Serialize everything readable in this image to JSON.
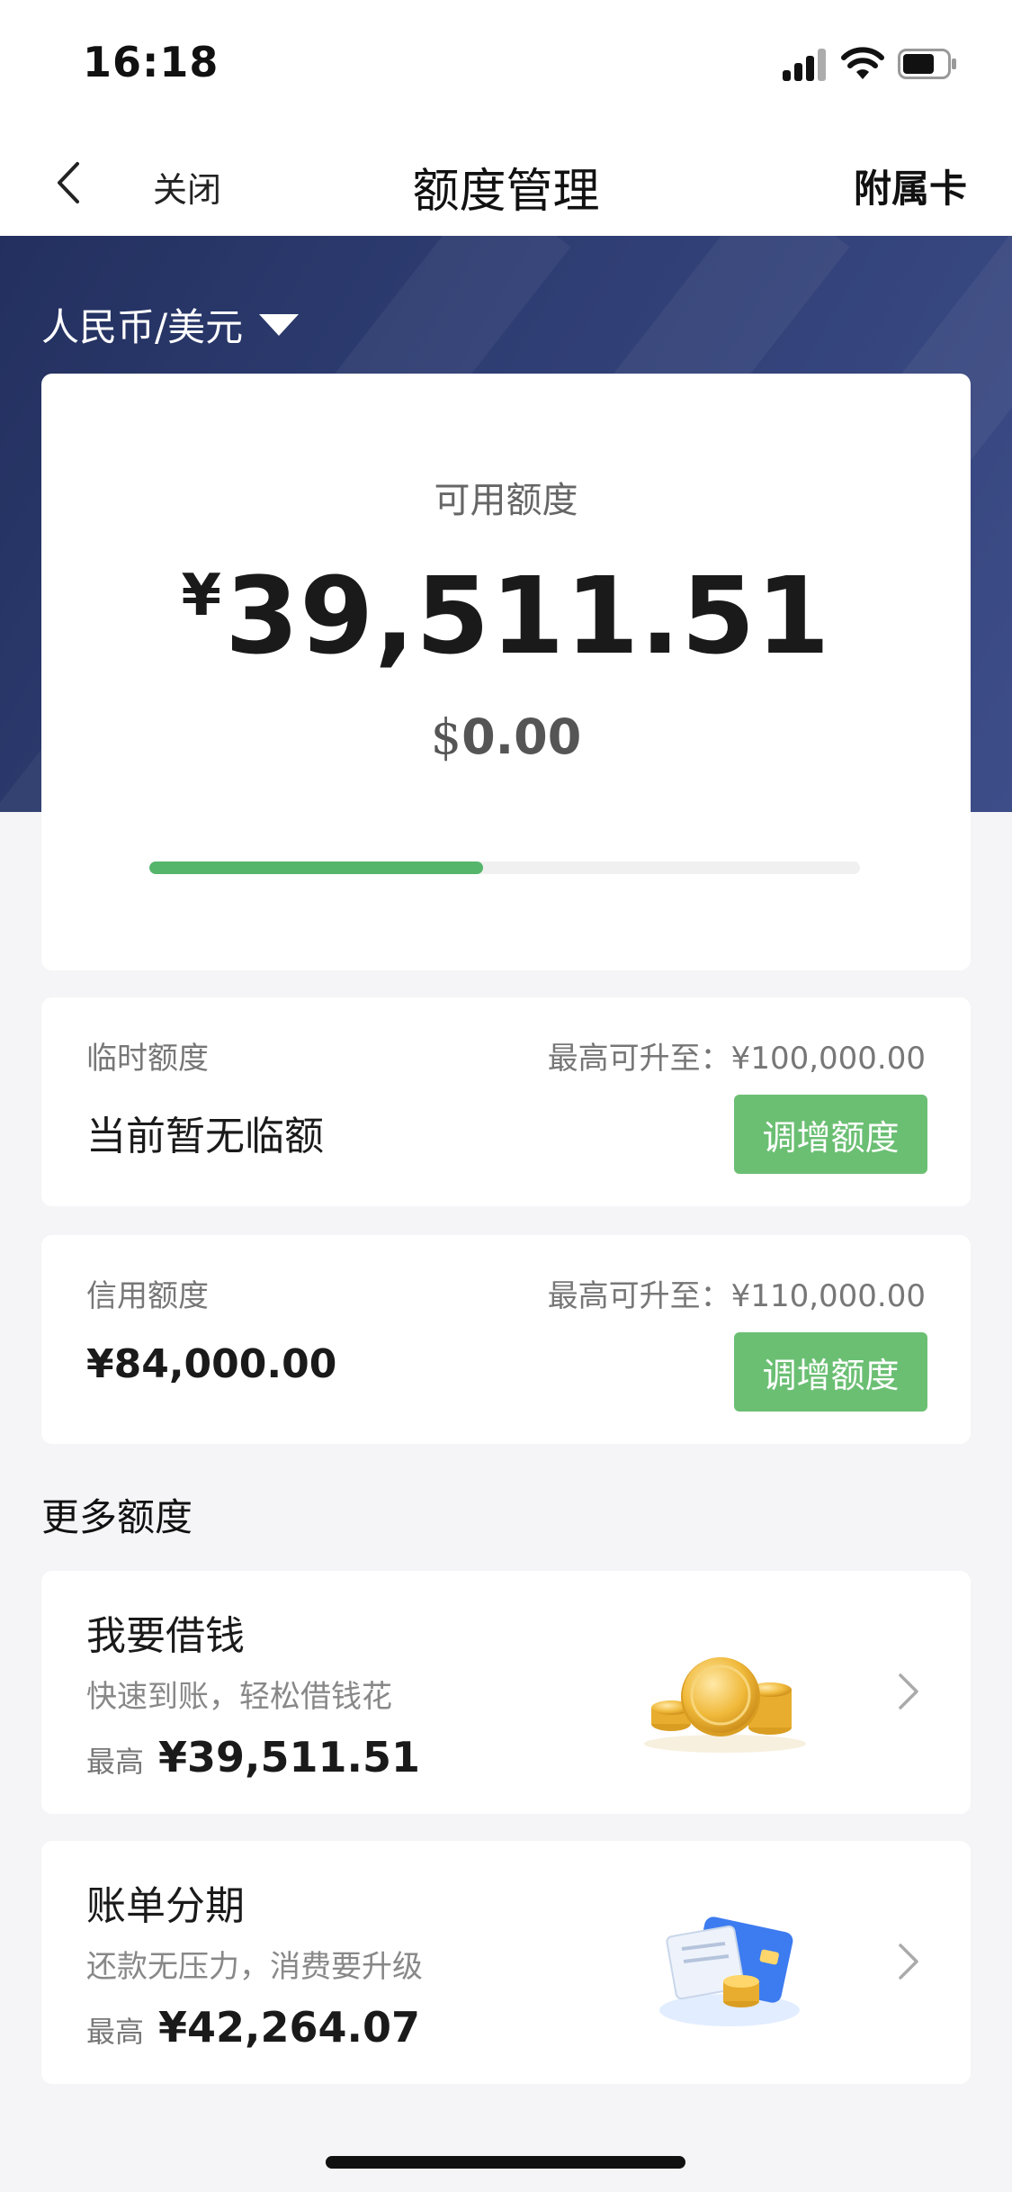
{
  "status_bar": {
    "time": "16:18"
  },
  "nav": {
    "close_label": "关闭",
    "title": "额度管理",
    "right_label": "附属卡"
  },
  "currency": {
    "selected": "人民币/美元"
  },
  "available": {
    "label": "可用额度",
    "cny_symbol": "¥",
    "cny_amount": "39,511.51",
    "usd_symbol": "$",
    "usd_amount": "0.00",
    "progress_ratio": 0.47
  },
  "temp_limit": {
    "label": "临时额度",
    "max_text": "最高可升至：¥100,000.00",
    "value": "当前暂无临额",
    "button_label": "调增额度"
  },
  "credit_limit": {
    "label": "信用额度",
    "max_text": "最高可升至：¥110,000.00",
    "value": "¥84,000.00",
    "button_label": "调增额度"
  },
  "more_section": {
    "title": "更多额度",
    "items": [
      {
        "title": "我要借钱",
        "subtitle": "快速到账，轻松借钱花",
        "max_label": "最高",
        "max_value": "¥39,511.51",
        "icon": "gold-coins-icon"
      },
      {
        "title": "账单分期",
        "subtitle": "还款无压力，消费要升级",
        "max_label": "最高",
        "max_value": "¥42,264.07",
        "icon": "bill-card-coins-icon"
      }
    ]
  },
  "colors": {
    "accent_green": "#6bbf73",
    "header_navy": "#2f3e74",
    "progress_green": "#55b56a"
  }
}
